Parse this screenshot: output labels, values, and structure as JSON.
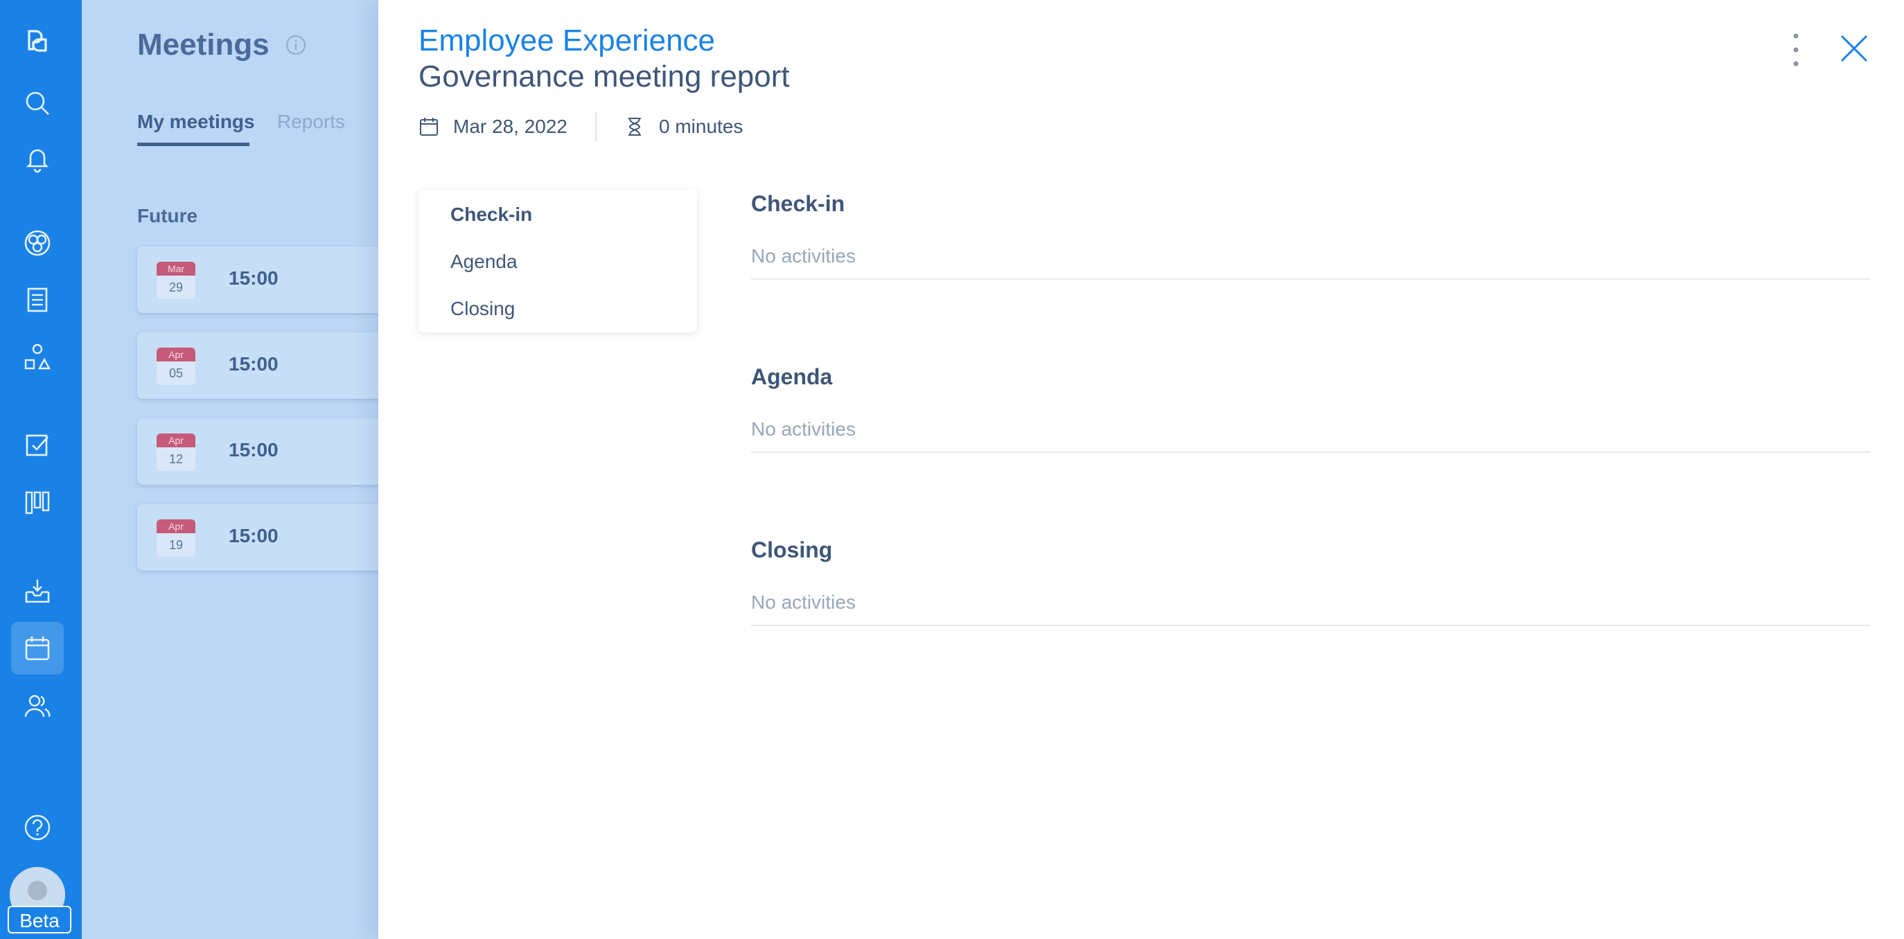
{
  "rail": {
    "beta_label": "Beta",
    "icons": [
      "logo-icon",
      "search-icon",
      "bell-icon",
      "circles-icon",
      "document-icon",
      "shapes-icon",
      "checkbox-icon",
      "kanban-icon",
      "inbox-icon",
      "calendar-icon",
      "users-icon",
      "help-icon"
    ],
    "active": "calendar-icon"
  },
  "background": {
    "title": "Meetings",
    "tabs": [
      {
        "label": "My meetings",
        "active": true
      },
      {
        "label": "Reports",
        "active": false
      }
    ],
    "section": "Future",
    "meetings": [
      {
        "month": "Mar",
        "day": "29",
        "time": "15:00"
      },
      {
        "month": "Apr",
        "day": "05",
        "time": "15:00"
      },
      {
        "month": "Apr",
        "day": "12",
        "time": "15:00"
      },
      {
        "month": "Apr",
        "day": "19",
        "time": "15:00"
      }
    ]
  },
  "panel": {
    "circle": "Employee Experience",
    "title": "Governance meeting report",
    "date": "Mar 28, 2022",
    "duration": "0 minutes",
    "nav": [
      {
        "label": "Check-in",
        "active": true
      },
      {
        "label": "Agenda",
        "active": false
      },
      {
        "label": "Closing",
        "active": false
      }
    ],
    "sections": [
      {
        "heading": "Check-in",
        "empty": "No activities"
      },
      {
        "heading": "Agenda",
        "empty": "No activities"
      },
      {
        "heading": "Closing",
        "empty": "No activities"
      }
    ]
  },
  "colors": {
    "rail": "#1a82e6",
    "accent": "#1a82e6",
    "text": "#3f5677",
    "muted": "#98a6ba"
  }
}
